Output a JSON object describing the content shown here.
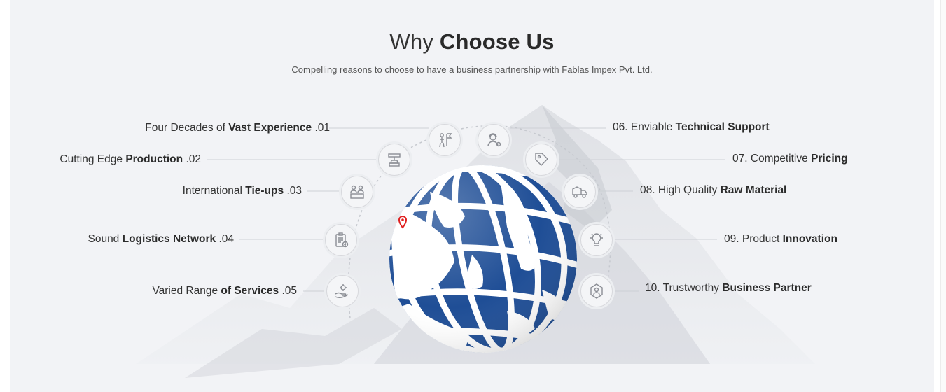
{
  "header": {
    "title_light": "Why",
    "title_bold": "Choose Us",
    "subtitle": "Compelling reasons to choose to have a business partnership with Fablas Impex Pvt. Ltd."
  },
  "reasons_left": [
    {
      "prefix": "Four Decades of ",
      "bold": "Vast Experience",
      "number": ".01",
      "icon": "flag-person-icon"
    },
    {
      "prefix": "Cutting Edge ",
      "bold": "Production",
      "number": ".02",
      "icon": "machine-icon"
    },
    {
      "prefix": "International ",
      "bold": "Tie-ups",
      "number": ".03",
      "icon": "partners-icon"
    },
    {
      "prefix": "Sound ",
      "bold": "Logistics Network",
      "number": ".04",
      "icon": "clipboard-check-icon"
    },
    {
      "prefix": "Varied Range ",
      "bold": "of Services",
      "number": ".05",
      "icon": "hand-gear-icon"
    }
  ],
  "reasons_right": [
    {
      "number": "06.",
      "prefix": " Enviable ",
      "bold": "Technical Support",
      "icon": "support-agent-icon"
    },
    {
      "number": "07.",
      "prefix": " Competitive ",
      "bold": "Pricing",
      "icon": "price-tag-icon"
    },
    {
      "number": "08.",
      "prefix": " High Quality ",
      "bold": "Raw Material",
      "icon": "truck-icon"
    },
    {
      "number": "09.",
      "prefix": " Product ",
      "bold": "Innovation",
      "icon": "lightbulb-gear-icon"
    },
    {
      "number": "10.",
      "prefix": " Trustworthy ",
      "bold": "Business Partner",
      "icon": "handshake-network-icon"
    }
  ],
  "colors": {
    "globe_blue": "#1f4e96",
    "panel_bg": "#f2f3f6",
    "line": "#cfd1d6",
    "pin": "#e02020"
  }
}
